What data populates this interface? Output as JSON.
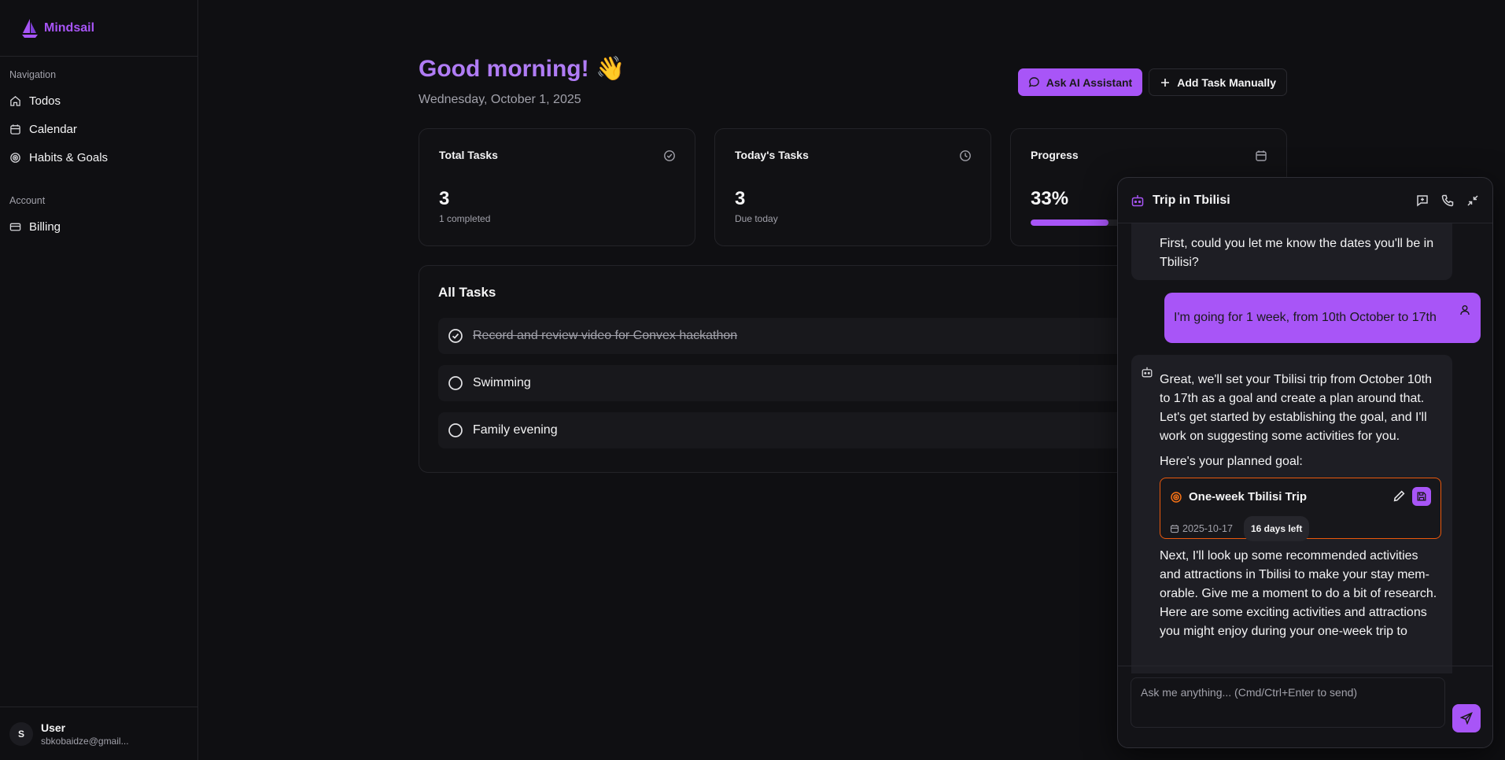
{
  "brand": {
    "name": "Mindsail",
    "logo_icon": "sailboat-icon",
    "color": "#a855f7"
  },
  "sidebar": {
    "nav_heading": "Navigation",
    "nav_items": [
      {
        "label": "Todos",
        "icon": "home-icon"
      },
      {
        "label": "Calendar",
        "icon": "calendar-icon"
      },
      {
        "label": "Habits & Goals",
        "icon": "target-icon"
      }
    ],
    "account_heading": "Account",
    "account_items": [
      {
        "label": "Billing",
        "icon": "credit-card-icon"
      }
    ],
    "user": {
      "initial": "S",
      "name": "User",
      "email": "sbkobaidze@gmail..."
    }
  },
  "header": {
    "greeting": "Good morning! 👋",
    "date": "Wednesday, October 1, 2025",
    "ask_ai_label": "Ask AI Assistant",
    "add_task_label": "Add Task Manually"
  },
  "stats": {
    "total": {
      "title": "Total Tasks",
      "value": "3",
      "sub": "1 completed"
    },
    "today": {
      "title": "Today's Tasks",
      "value": "3",
      "sub": "Due today"
    },
    "progress": {
      "title": "Progress",
      "value": "33%",
      "fraction": 0.33
    }
  },
  "tasks": {
    "title": "All Tasks",
    "items": [
      {
        "label": "Record and review video for Convex hackathon",
        "done": true
      },
      {
        "label": "Swimming",
        "done": false
      },
      {
        "label": "Family evening",
        "done": false
      }
    ]
  },
  "chat": {
    "title": "Trip in Tbilisi",
    "messages": {
      "bot_1": "First, could you let me know the dates you'll be in Tbilisi?",
      "user_1": "I'm going for 1 week, from 10th October to 17th",
      "bot_2_intro": "Great, we'll set your Tbilisi trip from October 10th to 17th as a goal and create a plan around that. Let's get started by establishing the goal, and I'll work on suggesting some activities for you.",
      "bot_2_goal_lead": "Here's your planned goal:",
      "bot_2_outro": "Next, I'll look up some recommended activities and attractions in Tbilisi to make your stay mem-orable. Give me a moment to do a bit of research. Here are some exciting activities and attractions you might enjoy during your one-week trip to"
    },
    "goal": {
      "title": "One-week Tbilisi Trip",
      "date": "2025-10-17",
      "badge": "16 days left"
    },
    "input_placeholder": "Ask me anything... (Cmd/Ctrl+Enter to send)"
  }
}
